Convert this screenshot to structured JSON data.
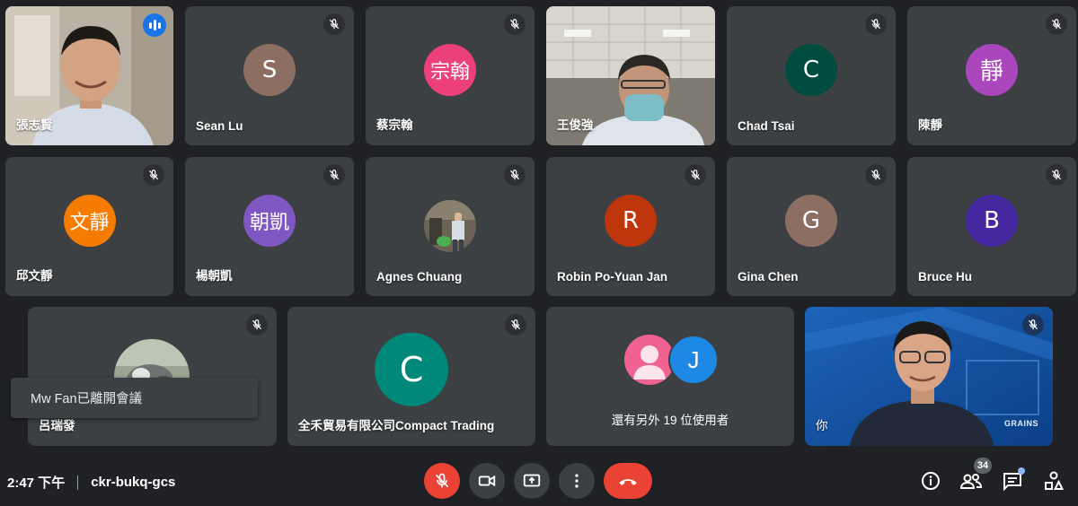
{
  "participants": [
    {
      "name": "張志賢",
      "mode": "video",
      "speaking": true
    },
    {
      "name": "Sean Lu",
      "initial": "S",
      "color": "#8d6e63"
    },
    {
      "name": "蔡宗翰",
      "initial": "宗翰",
      "color": "#ec407a"
    },
    {
      "name": "王俊強",
      "mode": "video"
    },
    {
      "name": "Chad Tsai",
      "initial": "C",
      "color": "#004d40"
    },
    {
      "name": "陳靜",
      "initial": "靜",
      "color": "#ab47bc"
    },
    {
      "name": "邱文靜",
      "initial": "文靜",
      "color": "#f57c00"
    },
    {
      "name": "楊朝凱",
      "initial": "朝凱",
      "color": "#7e57c2"
    },
    {
      "name": "Agnes Chuang",
      "mode": "photo"
    },
    {
      "name": "Robin Po-Yuan Jan",
      "initial": "R",
      "color": "#c0360c"
    },
    {
      "name": "Gina Chen",
      "initial": "G",
      "color": "#8d6e63"
    },
    {
      "name": "Bruce Hu",
      "initial": "B",
      "color": "#4527a0"
    },
    {
      "name": "呂瑞發",
      "mode": "photo"
    },
    {
      "name": "全禾貿易有限公司Compact Trading",
      "initial": "C",
      "color": "#00897b"
    },
    {
      "name": "你",
      "mode": "video"
    }
  ],
  "others_tile": {
    "label": "還有另外 19 位使用者",
    "initial": "J",
    "colors": [
      "#f06292",
      "#1e88e5"
    ]
  },
  "self_video_text": "GRAINS",
  "toast": "Mw Fan已離開會議",
  "bottom": {
    "time": "2:47 下午",
    "meeting_code": "ckr-bukq-gcs",
    "participant_count": "34"
  },
  "colors": {
    "accent": "#8ab4f8",
    "danger": "#ea4335",
    "tile": "#3c4043",
    "bg": "#202124"
  },
  "icons": [
    "mic-off-icon",
    "videocam-icon",
    "present-icon",
    "more-vert-icon",
    "call-end-icon",
    "info-icon",
    "people-icon",
    "chat-icon",
    "activities-icon"
  ]
}
